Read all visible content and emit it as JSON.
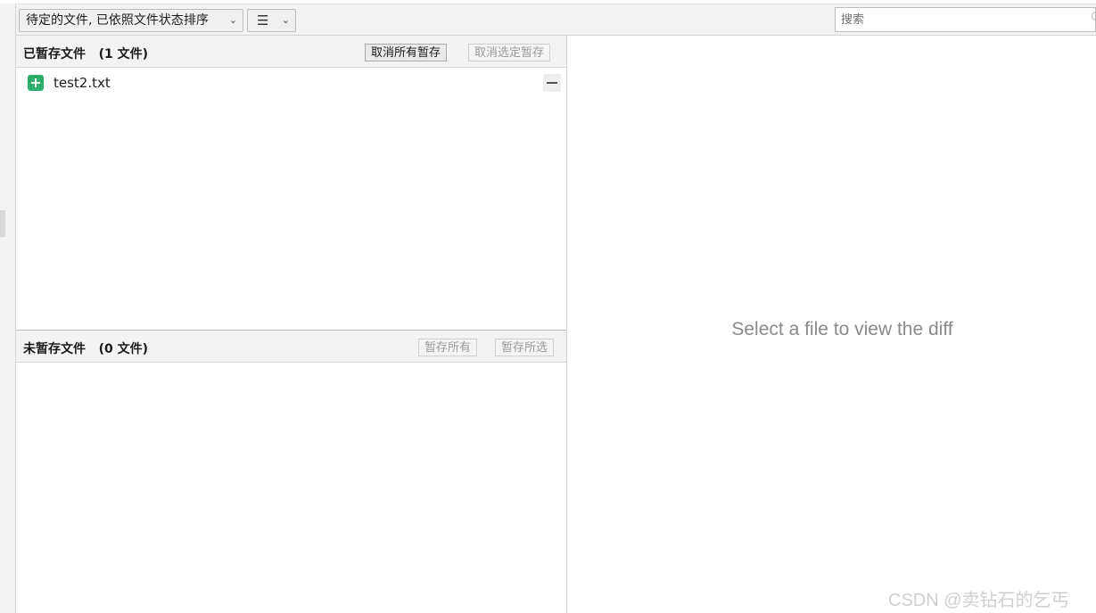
{
  "toolbar": {
    "sort_label": "待定的文件, 已依照文件状态排序",
    "view_icon": "list-menu-icon",
    "search_placeholder": "搜索"
  },
  "staged": {
    "title": "已暂存文件   (1 文件)",
    "unstage_all_label": "取消所有暂存",
    "unstage_selected_label": "取消选定暂存",
    "files": [
      {
        "name": "test2.txt",
        "status": "added",
        "status_color": "#2fae6b"
      }
    ]
  },
  "unstaged": {
    "title": "未暂存文件   (0 文件)",
    "stage_all_label": "暂存所有",
    "stage_selected_label": "暂存所选"
  },
  "diff": {
    "placeholder": "Select a file to view the diff"
  },
  "watermark": "CSDN @卖钻石的乞丐"
}
